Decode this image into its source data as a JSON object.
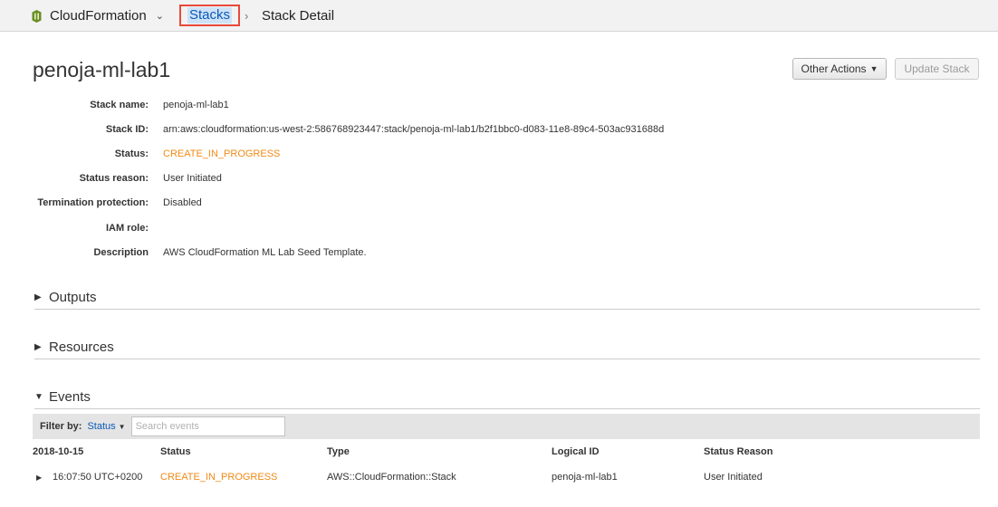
{
  "header": {
    "service_name": "CloudFormation",
    "breadcrumb_stacks": "Stacks",
    "breadcrumb_separator": "›",
    "breadcrumb_current": "Stack Detail",
    "icons": {
      "service": "cloudformation-icon",
      "chevron": "chevron-down-icon"
    }
  },
  "page": {
    "title": "penoja-ml-lab1",
    "actions": {
      "other_actions": "Other Actions",
      "update_stack": "Update Stack"
    }
  },
  "details": [
    {
      "label": "Stack name:",
      "value": "penoja-ml-lab1"
    },
    {
      "label": "Stack ID:",
      "value": "arn:aws:cloudformation:us-west-2:586768923447:stack/penoja-ml-lab1/b2f1bbc0-d083-11e8-89c4-503ac931688d"
    },
    {
      "label": "Status:",
      "value": "CREATE_IN_PROGRESS"
    },
    {
      "label": "Status reason:",
      "value": "User Initiated"
    },
    {
      "label": "Termination protection:",
      "value": "Disabled"
    },
    {
      "label": "IAM role:",
      "value": ""
    },
    {
      "label": "Description",
      "value": "AWS CloudFormation ML Lab Seed Template."
    }
  ],
  "sections": {
    "outputs": "Outputs",
    "resources": "Resources",
    "events": "Events"
  },
  "events": {
    "filter_label": "Filter by:",
    "filter_value": "Status",
    "search_placeholder": "Search events",
    "columns": {
      "date": "2018-10-15",
      "status": "Status",
      "type": "Type",
      "logical_id": "Logical ID",
      "status_reason": "Status Reason"
    },
    "rows": [
      {
        "time": "16:07:50 UTC+0200",
        "status": "CREATE_IN_PROGRESS",
        "type": "AWS::CloudFormation::Stack",
        "logical_id": "penoja-ml-lab1",
        "status_reason": "User Initiated"
      }
    ]
  },
  "colors": {
    "status_in_progress": "#f08a16",
    "link": "#0a59b8",
    "highlight_border": "#e8493a"
  }
}
